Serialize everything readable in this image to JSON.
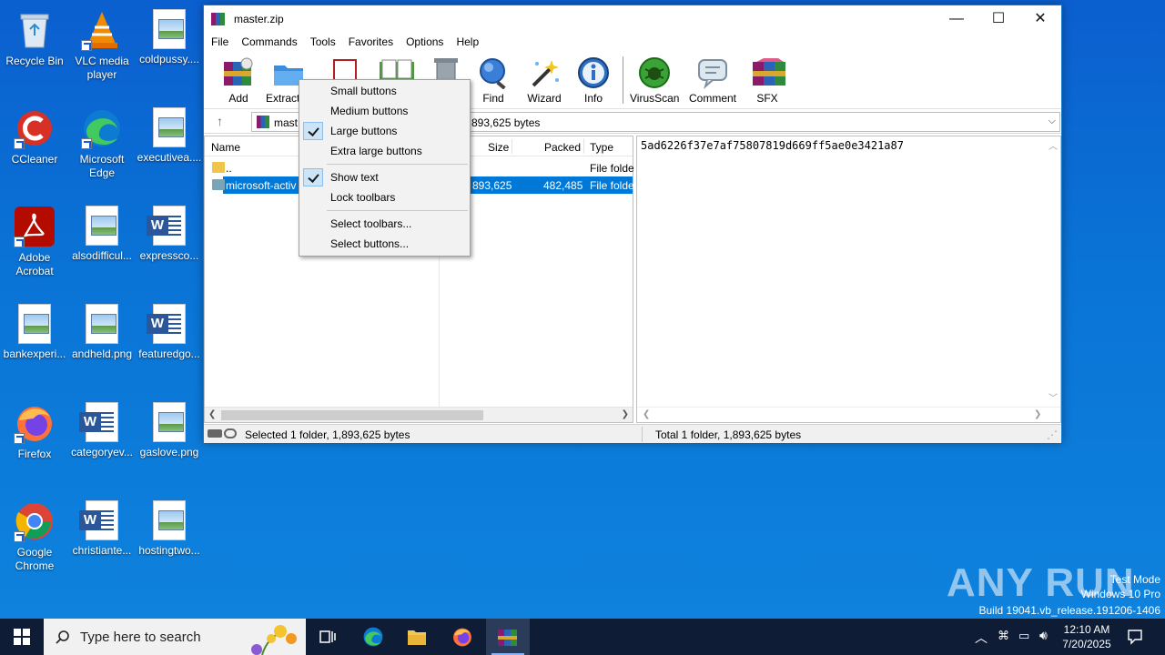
{
  "desktop": {
    "icons": [
      {
        "label": "Recycle Bin",
        "icon": "recycle-bin-icon"
      },
      {
        "label": "VLC media player",
        "icon": "vlc-icon"
      },
      {
        "label": "coldpussy....",
        "icon": "image-file-icon"
      },
      {
        "label": "CCleaner",
        "icon": "ccleaner-icon"
      },
      {
        "label": "Microsoft Edge",
        "icon": "edge-icon"
      },
      {
        "label": "executivea....",
        "icon": "image-file-icon"
      },
      {
        "label": "Adobe Acrobat",
        "icon": "acrobat-icon"
      },
      {
        "label": "alsodifficul...",
        "icon": "image-file-icon"
      },
      {
        "label": "expressco...",
        "icon": "word-doc-icon"
      },
      {
        "label": "bankexperi...",
        "icon": "image-file-icon"
      },
      {
        "label": "andheld.png",
        "icon": "image-file-icon"
      },
      {
        "label": "featuredgo...",
        "icon": "word-doc-icon"
      },
      {
        "label": "Firefox",
        "icon": "firefox-icon"
      },
      {
        "label": "categoryev...",
        "icon": "word-doc-icon"
      },
      {
        "label": "gaslove.png",
        "icon": "image-file-icon"
      },
      {
        "label": "Google Chrome",
        "icon": "chrome-icon"
      },
      {
        "label": "christiante...",
        "icon": "word-doc-icon"
      },
      {
        "label": "hostingtwo...",
        "icon": "image-file-icon"
      }
    ]
  },
  "window": {
    "title": "master.zip",
    "controls": {
      "minimize": "—",
      "maximize": "☐",
      "close": "✕"
    },
    "menu": [
      "File",
      "Commands",
      "Tools",
      "Favorites",
      "Options",
      "Help"
    ],
    "toolbar": {
      "add": "Add",
      "extract": "Extract",
      "find": "Find",
      "wizard": "Wizard",
      "info": "Info",
      "virusscan": "VirusScan",
      "comment": "Comment",
      "sfx": "SFX"
    },
    "address": {
      "text_left": "mast",
      "text_right": "893,625 bytes"
    },
    "columns": {
      "name": "Name",
      "size": "Size",
      "packed": "Packed",
      "type": "Type"
    },
    "rows": [
      {
        "name": "..",
        "size": "",
        "packed": "",
        "type": "File folde"
      },
      {
        "name": "microsoft-activ",
        "size": "893,625",
        "packed": "482,485",
        "type": "File folde"
      }
    ],
    "comment_text": "5ad6226f37e7af75807819d669ff5ae0e3421a87",
    "status": {
      "left": "Selected 1 folder, 1,893,625 bytes",
      "right": "Total 1 folder, 1,893,625 bytes"
    }
  },
  "context_menu": {
    "items": [
      {
        "label": "Small buttons",
        "checked": false
      },
      {
        "label": "Medium buttons",
        "checked": false
      },
      {
        "label": "Large buttons",
        "checked": true
      },
      {
        "label": "Extra large buttons",
        "checked": false
      },
      {
        "label": "Show text",
        "checked": true
      },
      {
        "label": "Lock toolbars",
        "checked": false
      },
      {
        "label": "Select toolbars...",
        "checked": false
      },
      {
        "label": "Select buttons...",
        "checked": false
      }
    ]
  },
  "taskbar": {
    "search_placeholder": "Type here to search",
    "time": "12:10 AM",
    "date": "7/20/2025"
  },
  "watermark": {
    "brand": "ANY RUN",
    "line1": "Test Mode",
    "line2": "Windows 10 Pro",
    "line3": "Build 19041.vb_release.191206-1406"
  },
  "colors": {
    "accent": "#0078d7",
    "desktop": "#0a70d4",
    "taskbar": "#0e1c36"
  }
}
